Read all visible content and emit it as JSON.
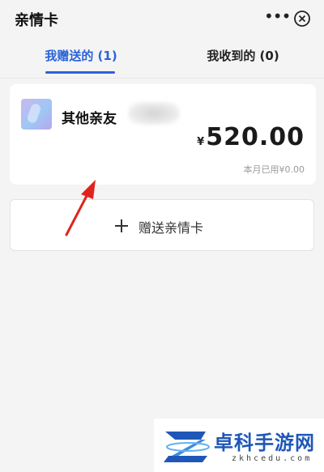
{
  "header": {
    "title": "亲情卡"
  },
  "tabs": [
    {
      "label": "我赠送的 (1)",
      "active": true
    },
    {
      "label": "我收到的 (0)",
      "active": false
    }
  ],
  "card": {
    "name": "其他亲友",
    "currency": "¥",
    "amount": "520.00",
    "used_text": "本月已用¥0.00"
  },
  "add_card": {
    "label": "赠送亲情卡"
  },
  "watermark": {
    "name": "卓科手游网",
    "domain": "zkhcedu.com"
  },
  "colors": {
    "accent": "#2a62d8",
    "arrow": "#e0241c",
    "watermark": "#1f57b8"
  }
}
